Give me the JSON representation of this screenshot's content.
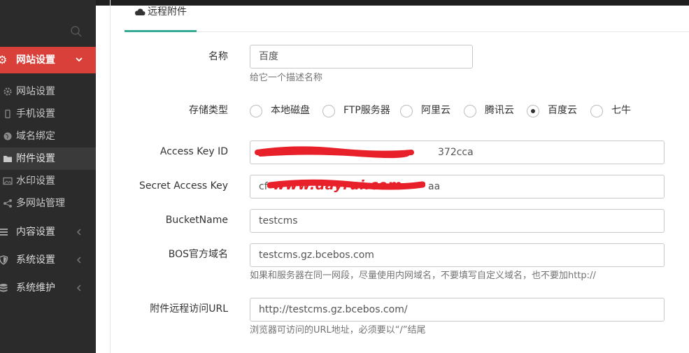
{
  "sidebar": {
    "active_section": {
      "label": "网站设置",
      "icon": "gear-icon"
    },
    "sub_items": [
      {
        "label": "网站设置",
        "icon": "gear-icon"
      },
      {
        "label": "手机设置",
        "icon": "mobile-icon"
      },
      {
        "label": "域名绑定",
        "icon": "globe-icon"
      },
      {
        "label": "附件设置",
        "icon": "folder-icon"
      },
      {
        "label": "水印设置",
        "icon": "image-icon"
      },
      {
        "label": "多网站管理",
        "icon": "share-icon"
      }
    ],
    "groups": [
      {
        "label": "内容设置",
        "icon": "list-icon"
      },
      {
        "label": "系统设置",
        "icon": "shield-icon"
      },
      {
        "label": "系统维护",
        "icon": "database-icon"
      }
    ]
  },
  "tab": {
    "label": "远程附件",
    "icon": "cloud-icon"
  },
  "form": {
    "name": {
      "label": "名称",
      "value": "百度",
      "help": "给它一个描述名称"
    },
    "storage": {
      "label": "存储类型",
      "options": [
        "本地磁盘",
        "FTP服务器",
        "阿里云",
        "腾讯云",
        "百度云",
        "七牛"
      ],
      "selected": "百度云"
    },
    "access_key_id": {
      "label": "Access Key ID",
      "value": "372cca"
    },
    "secret_access_key": {
      "label": "Secret Access Key",
      "value_prefix": "cf",
      "value_suffix": "aa",
      "watermark": "www.dayrui.com"
    },
    "bucket_name": {
      "label": "BucketName",
      "value": "testcms"
    },
    "bos_domain": {
      "label": "BOS官方域名",
      "value": "testcms.gz.bcebos.com",
      "help": "如果和服务器在同一网段，尽量使用内网域名，不要填写自定义域名，也不要加http://"
    },
    "remote_url": {
      "label": "附件远程访问URL",
      "value": "http://testcms.gz.bcebos.com/",
      "help": "浏览器可访问的URL地址，必须要以“/”结尾"
    }
  },
  "colors": {
    "accent_red": "#d9403a",
    "tab_underline": "#35aa95",
    "sidebar_bg": "#2b2b2b",
    "scribble_red": "#e8202a"
  }
}
